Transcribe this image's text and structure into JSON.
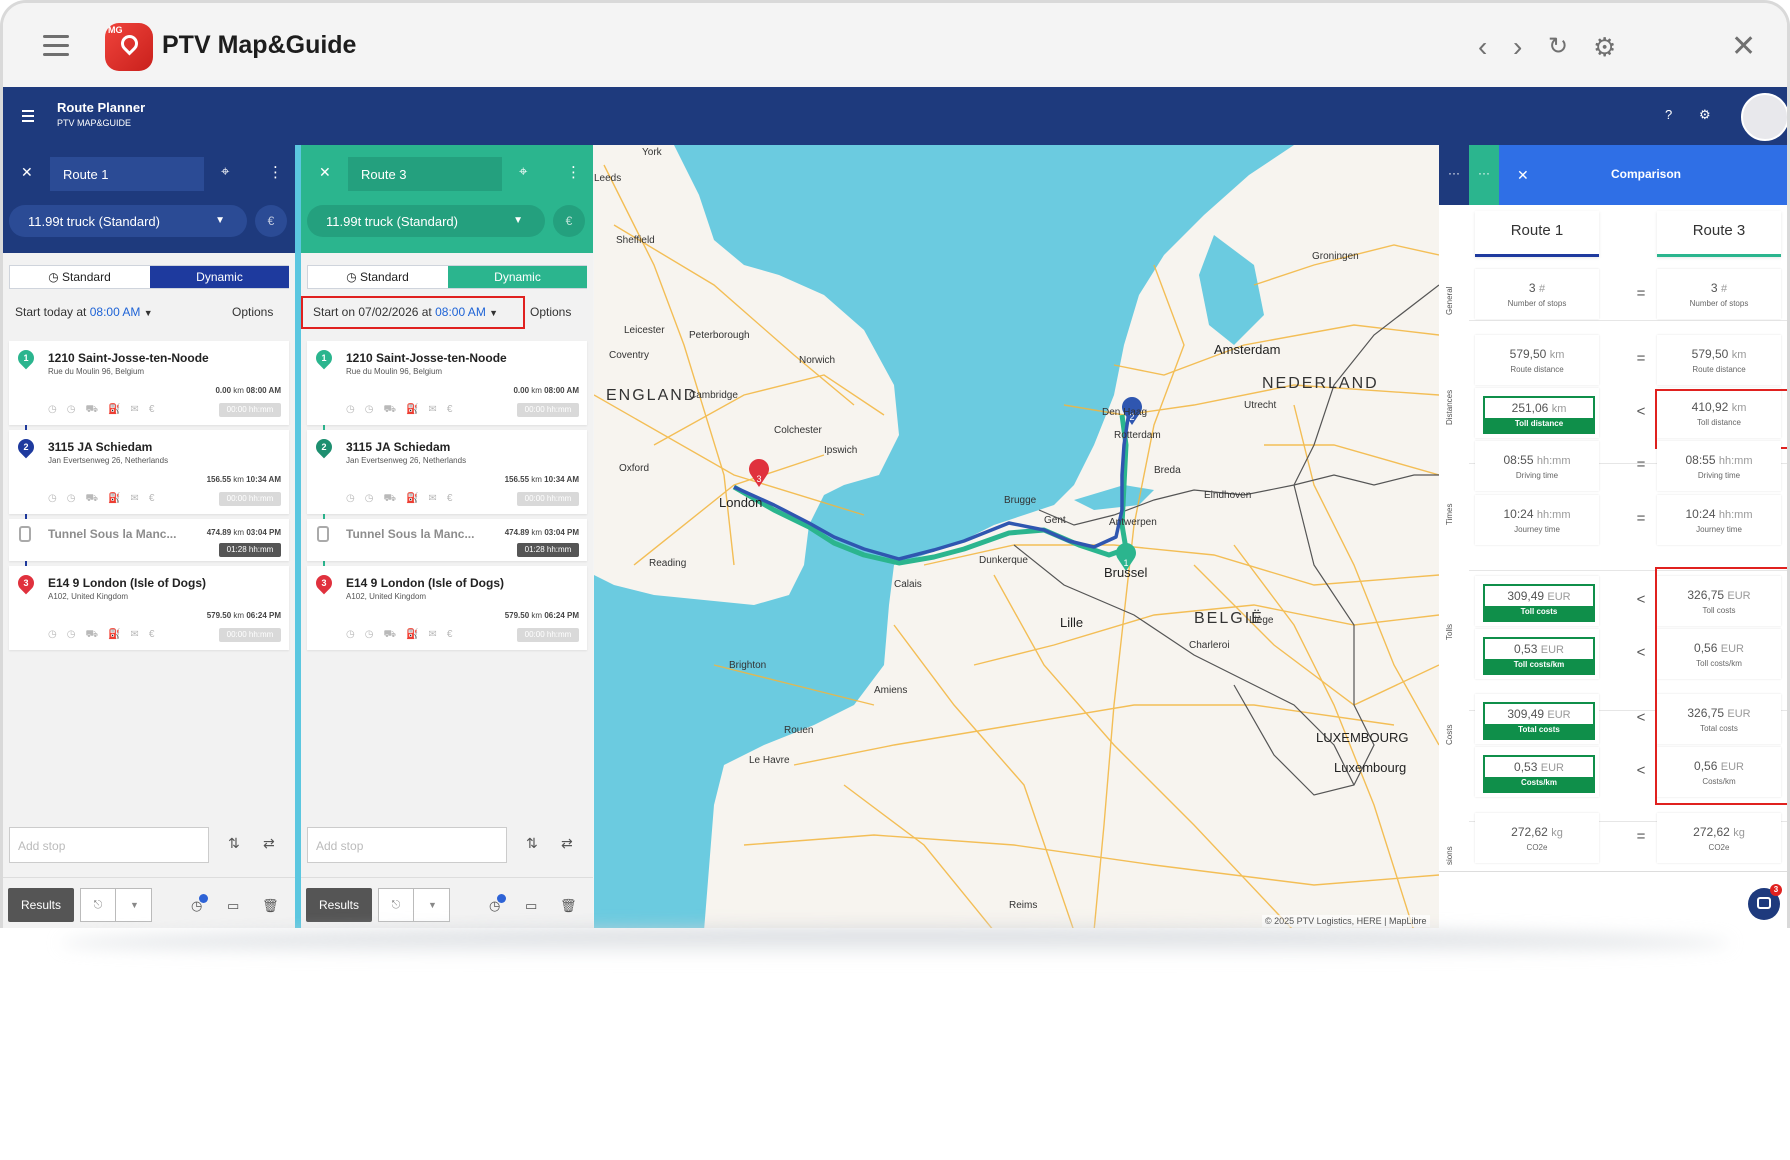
{
  "app": {
    "brand": "PTV Map&Guide",
    "logo_mark": "MG"
  },
  "header": {
    "title": "Route Planner",
    "subtitle": "PTV MAP&GUIDE",
    "help_icon": "?"
  },
  "panels": [
    {
      "name": "Route 1",
      "vehicle": "11.99t truck (Standard)",
      "tab_standard": "Standard",
      "tab_dynamic": "Dynamic",
      "start_prefix": "Start today at",
      "start_time": "08:00 AM",
      "options": "Options",
      "accent": "#1e3a7d",
      "stops": [
        {
          "num": "1",
          "name": "1210 Saint-Josse-ten-Noode",
          "addr": "Rue du Moulin 96, Belgium",
          "dist": "0.00",
          "time": "08:00 AM",
          "hh": "00:00 hh:mm",
          "color": "#2bb58e"
        },
        {
          "num": "2",
          "name": "3115 JA Schiedam",
          "addr": "Jan Evertsenweg 26, Netherlands",
          "dist": "156.55",
          "time": "10:34 AM",
          "hh": "00:00 hh:mm",
          "color": "#1e3a9e"
        },
        {
          "num": "",
          "name": "Tunnel Sous la Manc...",
          "addr": "",
          "dist": "474.89",
          "time": "03:04 PM",
          "hh": "01:28 hh:mm",
          "color": "#aaa"
        },
        {
          "num": "3",
          "name": "E14 9 London (Isle of Dogs)",
          "addr": "A102, United Kingdom",
          "dist": "579.50",
          "time": "06:24 PM",
          "hh": "00:00 hh:mm",
          "color": "#e0313d"
        }
      ],
      "add_stop": "Add stop",
      "results": "Results"
    },
    {
      "name": "Route 3",
      "vehicle": "11.99t truck (Standard)",
      "tab_standard": "Standard",
      "tab_dynamic": "Dynamic",
      "start_prefix": "Start on 07/02/2026 at",
      "start_time": "08:00 AM",
      "options": "Options",
      "accent": "#2bb58e",
      "stops": [
        {
          "num": "1",
          "name": "1210 Saint-Josse-ten-Noode",
          "addr": "Rue du Moulin 96, Belgium",
          "dist": "0.00",
          "time": "08:00 AM",
          "hh": "00:00 hh:mm",
          "color": "#2bb58e"
        },
        {
          "num": "2",
          "name": "3115 JA Schiedam",
          "addr": "Jan Evertsenweg 26, Netherlands",
          "dist": "156.55",
          "time": "10:34 AM",
          "hh": "00:00 hh:mm",
          "color": "#1e8f70"
        },
        {
          "num": "",
          "name": "Tunnel Sous la Manc...",
          "addr": "",
          "dist": "474.89",
          "time": "03:04 PM",
          "hh": "01:28 hh:mm",
          "color": "#aaa"
        },
        {
          "num": "3",
          "name": "E14 9 London (Isle of Dogs)",
          "addr": "A102, United Kingdom",
          "dist": "579.50",
          "time": "06:24 PM",
          "hh": "00:00 hh:mm",
          "color": "#e0313d"
        }
      ],
      "add_stop": "Add stop",
      "results": "Results"
    }
  ],
  "map": {
    "countries": {
      "england": "ENGLAND",
      "nederland": "NEDERLAND",
      "belgie": "BELGIË",
      "luxembourg": "LUXEMBOURG"
    },
    "cities": {
      "amsterdam": "Amsterdam",
      "london": "London",
      "rotterdam": "Rotterdam",
      "antwerpen": "Antwerpen",
      "brussel": "Brussel",
      "lille": "Lille",
      "den_haag": "Den Haag",
      "luxembourg_city": "Luxembourg",
      "le_havre": "Le Havre",
      "reims": "Reims",
      "leeds": "Leeds",
      "york": "York",
      "sheffield": "Sheffield",
      "oxford": "Oxford",
      "reading": "Reading",
      "brighton": "Brighton",
      "calais": "Calais",
      "dunkerque": "Dunkerque",
      "liege": "Liège",
      "charleroi": "Charleroi",
      "ipswich": "Ipswich",
      "colchester": "Colchester",
      "cambridge": "Cambridge",
      "norwich": "Norwich",
      "peterborough": "Peterborough",
      "leicester": "Leicester",
      "coventry": "Coventry",
      "utrecht": "Utrecht",
      "eindhoven": "Eindhoven",
      "breda": "Breda",
      "gent": "Gent",
      "brugge": "Brugge",
      "amiens": "Amiens",
      "rouen": "Rouen",
      "groningen": "Groningen"
    },
    "copyright": "© 2025 PTV Logistics, HERE | MapLibre"
  },
  "comparison": {
    "title": "Comparison",
    "col1": "Route 1",
    "col2": "Route 3",
    "groups": {
      "general": "General",
      "distances": "Distances",
      "times": "Times",
      "tolls": "Tolls",
      "costs": "Costs",
      "emissions": "sions"
    },
    "rows": [
      {
        "label": "Number of stops",
        "v1": "3",
        "v2": "3",
        "unit": "#",
        "op": "="
      },
      {
        "label": "Route distance",
        "v1": "579,50",
        "v2": "579,50",
        "unit": "km",
        "op": "="
      },
      {
        "label": "Toll distance",
        "v1": "251,06",
        "v2": "410,92",
        "unit": "km",
        "op": "<"
      },
      {
        "label": "Driving time",
        "v1": "08:55",
        "v2": "08:55",
        "unit": "hh:mm",
        "op": "="
      },
      {
        "label": "Journey time",
        "v1": "10:24",
        "v2": "10:24",
        "unit": "hh:mm",
        "op": "="
      },
      {
        "label": "Toll costs",
        "v1": "309,49",
        "v2": "326,75",
        "unit": "EUR",
        "op": "<"
      },
      {
        "label": "Toll costs/km",
        "v1": "0,53",
        "v2": "0,56",
        "unit": "EUR",
        "op": "<"
      },
      {
        "label": "Total costs",
        "v1": "309,49",
        "v2": "326,75",
        "unit": "EUR",
        "op": "<"
      },
      {
        "label": "Costs/km",
        "v1": "0,53",
        "v2": "0,56",
        "unit": "EUR",
        "op": "<"
      },
      {
        "label": "CO2e",
        "v1": "272,62",
        "v2": "272,62",
        "unit": "kg",
        "op": "="
      }
    ],
    "dots": "···"
  },
  "chat_badge": "3",
  "units": {
    "km": "km"
  },
  "colors": {
    "route1": "#1e3a7d",
    "route3": "#2bb58e",
    "highlight": "#0f8f4a",
    "annotation": "#e0211f",
    "water": "#6bcbe0"
  }
}
